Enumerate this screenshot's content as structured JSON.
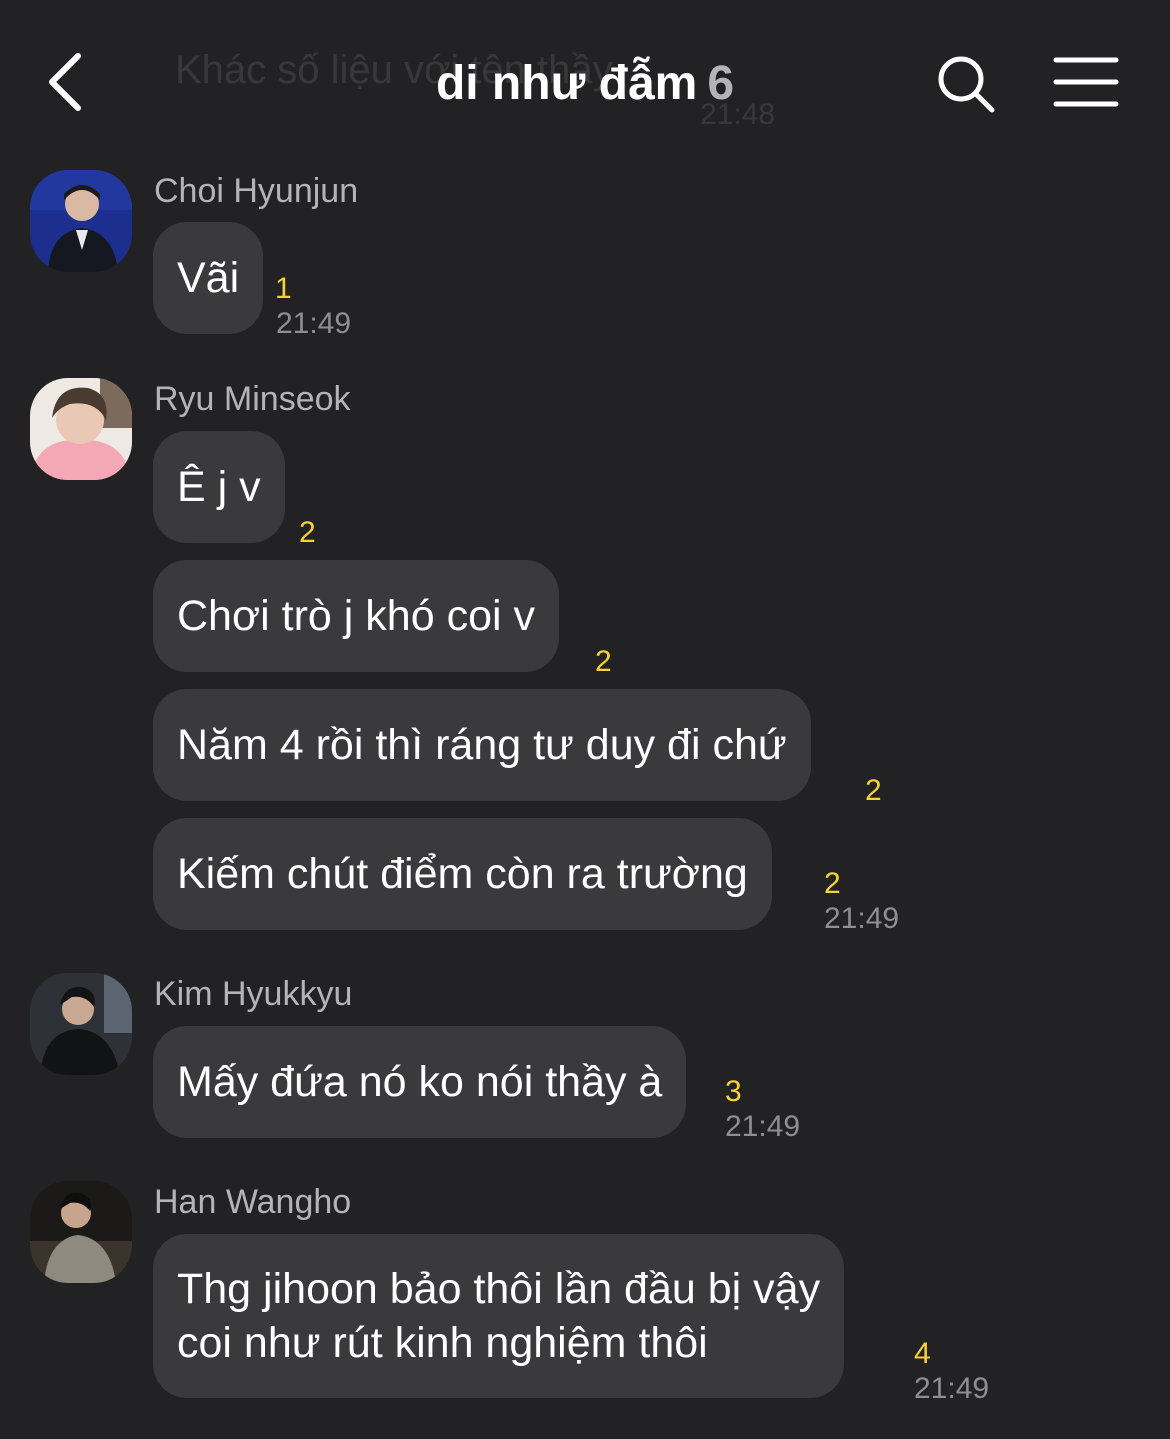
{
  "header": {
    "ghost_text": "Khác số liệu với tên thầy",
    "ghost_time": "21:48",
    "title": "di như đẫm",
    "member_count": "6",
    "back_icon": "chevron-left-icon",
    "search_icon": "search-icon",
    "menu_icon": "hamburger-menu-icon"
  },
  "groups": [
    {
      "sender": "Choi Hyunjun",
      "avatar": "avatar-photo",
      "messages": [
        {
          "text": "Vãi",
          "unread": "1",
          "time": "21:49"
        }
      ]
    },
    {
      "sender": "Ryu Minseok",
      "avatar": "avatar-photo",
      "messages": [
        {
          "text": "Ê j v",
          "unread": "2"
        },
        {
          "text": "Chơi trò j khó coi v",
          "unread": "2"
        },
        {
          "text": "Năm 4 rồi thì ráng tư duy đi chứ",
          "unread": "2"
        },
        {
          "text": "Kiếm chút điểm còn ra trường",
          "unread": "2",
          "time": "21:49"
        }
      ]
    },
    {
      "sender": "Kim Hyukkyu",
      "avatar": "avatar-photo",
      "messages": [
        {
          "text": "Mấy đứa nó ko nói thầy à",
          "unread": "3",
          "time": "21:49"
        }
      ]
    },
    {
      "sender": "Han Wangho",
      "avatar": "avatar-photo",
      "messages": [
        {
          "lines": [
            "Thg jihoon bảo thôi lần đầu bị vậy",
            "coi như rút kinh nghiệm thôi"
          ],
          "unread": "4",
          "time": "21:49"
        }
      ]
    }
  ],
  "colors": {
    "background": "#222224",
    "bubble": "#3a3a3c",
    "unread": "#f7d235",
    "time": "#8e8e93",
    "sender": "#b4b4b8"
  }
}
